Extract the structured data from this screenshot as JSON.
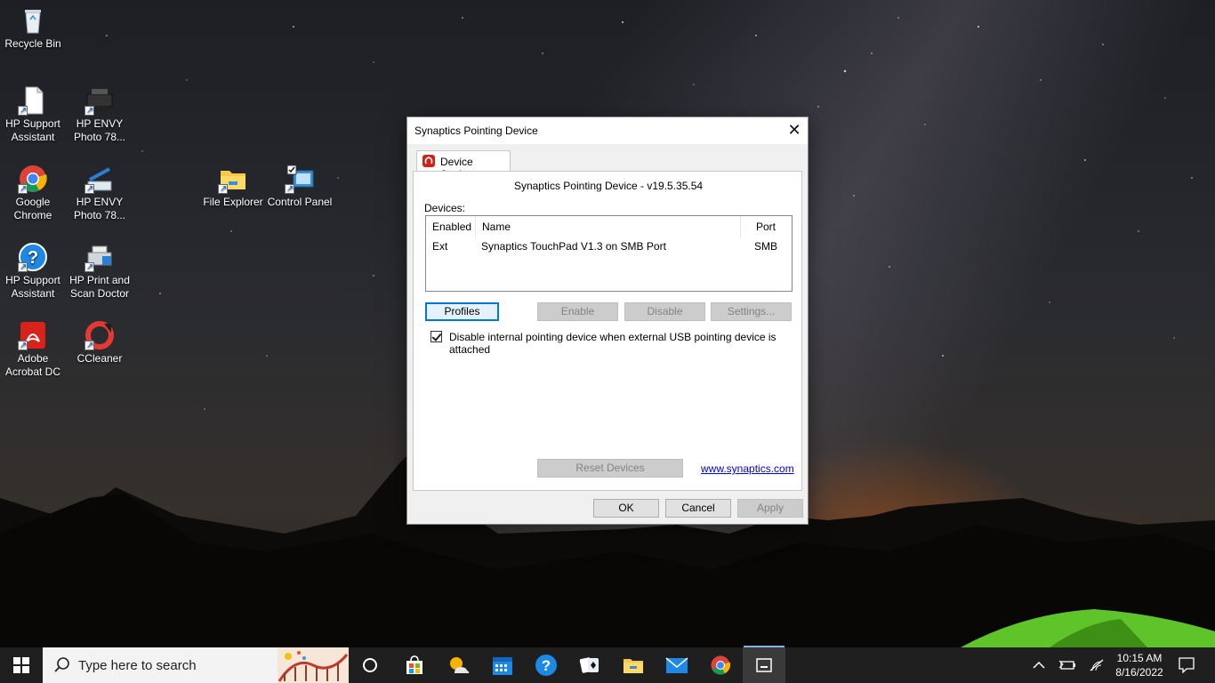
{
  "desktop": {
    "icons": [
      {
        "label": "Recycle Bin"
      },
      {
        "label": "HP Support Assistant"
      },
      {
        "label": "HP ENVY Photo 78..."
      },
      {
        "label": "Google Chrome"
      },
      {
        "label": "HP ENVY Photo 78..."
      },
      {
        "label": "File Explorer"
      },
      {
        "label": "Control Panel"
      },
      {
        "label": "HP Support Assistant"
      },
      {
        "label": "HP Print and Scan Doctor"
      },
      {
        "label": "Adobe Acrobat DC"
      },
      {
        "label": "CCleaner"
      }
    ]
  },
  "dialog": {
    "title": "Synaptics Pointing Device",
    "close_glyph": "✕",
    "tab_label": "Device Settings",
    "version": "Synaptics Pointing Device - v19.5.35.54",
    "devices_label": "Devices:",
    "table": {
      "headers": [
        "Enabled",
        "Name",
        "Port"
      ],
      "rows": [
        {
          "enabled": "Ext",
          "name": "Synaptics TouchPad V1.3 on SMB Port",
          "port": "SMB"
        }
      ]
    },
    "buttons": {
      "profiles": "Profiles",
      "enable": "Enable",
      "disable": "Disable",
      "settings": "Settings...",
      "reset": "Reset Devices",
      "ok": "OK",
      "cancel": "Cancel",
      "apply": "Apply"
    },
    "checkbox_label": "Disable internal pointing device when external USB pointing device is attached",
    "checkbox_checked": true,
    "link": "www.synaptics.com"
  },
  "taskbar": {
    "search_placeholder": "Type here to search",
    "clock_time": "10:15 AM",
    "clock_date": "8/16/2022",
    "pinned": [
      "cortana-icon",
      "microsoft-store-icon",
      "weather-icon",
      "calendar-icon",
      "get-help-icon",
      "solitaire-icon",
      "file-explorer-icon",
      "mail-icon",
      "chrome-icon",
      "synaptics-window-icon"
    ]
  },
  "colors": {
    "accent": "#0078d7",
    "taskbar": "#1f1f1f",
    "link": "#0000ee"
  }
}
